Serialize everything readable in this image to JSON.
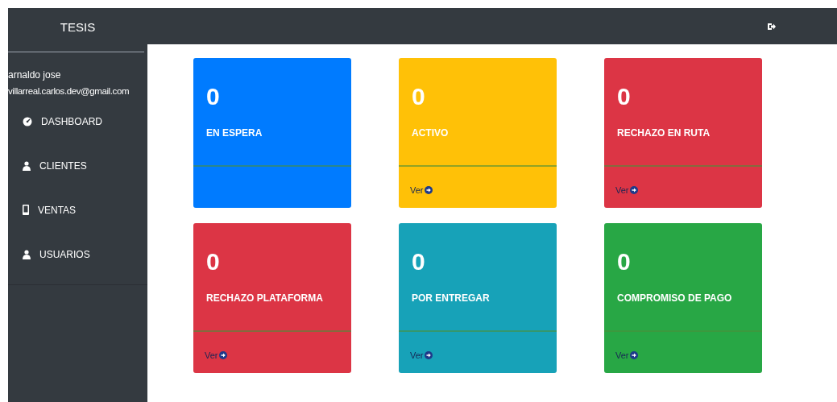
{
  "brand": "TESIS",
  "user": {
    "name": "arnaldo jose",
    "email": "villarreal.carlos.dev@gmail.com"
  },
  "menu": [
    {
      "label": "DASHBOARD",
      "kind": "dashboard"
    },
    {
      "label": "CLIENTES",
      "kind": "user"
    },
    {
      "label": "VENTAS",
      "kind": "phone"
    },
    {
      "label": "USUARIOS",
      "kind": "user"
    }
  ],
  "cards": [
    {
      "count": "0",
      "label": "EN ESPERA",
      "color": "#007bff"
    },
    {
      "count": "0",
      "label": "ACTIVO",
      "color": "#ffc107",
      "link": "Ver"
    },
    {
      "count": "0",
      "label": "RECHAZO EN RUTA",
      "color": "#dc3545",
      "link": "Ver"
    },
    {
      "count": "0",
      "label": "RECHAZO PLATAFORMA",
      "color": "#dc3545",
      "link": "Ver"
    },
    {
      "count": "0",
      "label": "POR ENTREGAR",
      "color": "#17a2b8",
      "link": "Ver"
    },
    {
      "count": "0",
      "label": "COMPROMISO DE PAGO",
      "color": "#28a745",
      "link": "Ver"
    }
  ]
}
